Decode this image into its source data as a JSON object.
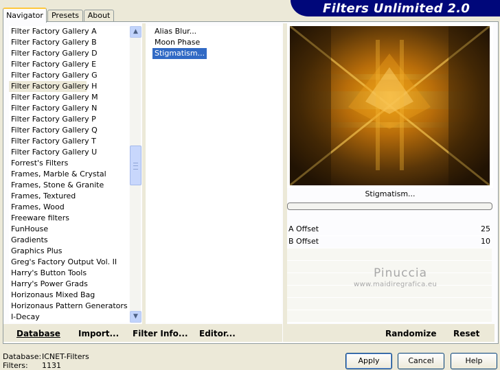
{
  "window": {
    "title": "Filters Unlimited 2.0"
  },
  "tabs": [
    {
      "label": "Navigator",
      "active": true
    },
    {
      "label": "Presets",
      "active": false
    },
    {
      "label": "About",
      "active": false
    }
  ],
  "categories": [
    "Filter Factory Gallery A",
    "Filter Factory Gallery B",
    "Filter Factory Gallery D",
    "Filter Factory Gallery E",
    "Filter Factory Gallery G",
    "Filter Factory Gallery H",
    "Filter Factory Gallery M",
    "Filter Factory Gallery N",
    "Filter Factory Gallery P",
    "Filter Factory Gallery Q",
    "Filter Factory Gallery T",
    "Filter Factory Gallery U",
    "Forrest's Filters",
    "Frames, Marble & Crystal",
    "Frames, Stone & Granite",
    "Frames, Textured",
    "Frames, Wood",
    "Freeware filters",
    "FunHouse",
    "Gradients",
    "Graphics Plus",
    "Greg's Factory Output Vol. II",
    "Harry's Button Tools",
    "Harry's Power Grads",
    "Horizonaus Mixed Bag",
    "Horizonaus Pattern Generators",
    "I-Decay"
  ],
  "selected_category": "Filter Factory Gallery H",
  "filters": [
    {
      "label": "Alias Blur..."
    },
    {
      "label": "Moon Phase"
    },
    {
      "label": "Stigmatism..."
    }
  ],
  "selected_filter": "Stigmatism...",
  "preview": {
    "filter_name": "Stigmatism...",
    "progress": 0
  },
  "params": [
    {
      "label": "A Offset",
      "value": "25"
    },
    {
      "label": "B Offset",
      "value": "10"
    }
  ],
  "watermark": {
    "name": "Pinuccia",
    "site": "www.maidiregrafica.eu"
  },
  "left_buttons": {
    "database": "Database",
    "import": "Import...",
    "filter_info": "Filter Info...",
    "editor": "Editor..."
  },
  "right_buttons": {
    "randomize": "Randomize",
    "reset": "Reset"
  },
  "footer": {
    "database_label": "Database:",
    "database_value": "ICNET-Filters",
    "filters_label": "Filters:",
    "filters_value": "1131"
  },
  "dialog_buttons": {
    "apply": "Apply",
    "cancel": "Cancel",
    "help": "Help"
  },
  "colors": {
    "banner": "#00077a",
    "selection": "#316ac5",
    "background": "#ece9d8"
  }
}
